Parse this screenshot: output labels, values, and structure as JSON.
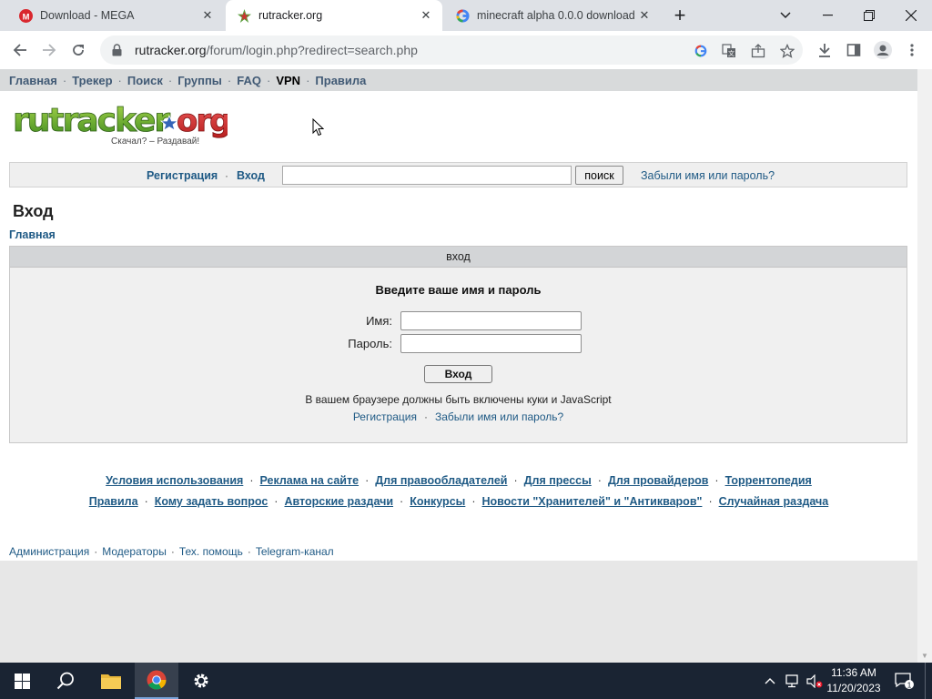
{
  "browser": {
    "tabs": [
      {
        "title": "Download - MEGA",
        "favicon": "mega-icon"
      },
      {
        "title": "rutracker.org",
        "favicon": "rutracker-icon",
        "active": true
      },
      {
        "title": "minecraft alpha 0.0.0 download",
        "favicon": "google-icon"
      }
    ],
    "new_tab_label": "+",
    "url_domain": "rutracker.org",
    "url_path": "/forum/login.php?redirect=search.php"
  },
  "topnav": {
    "items": [
      "Главная",
      "Трекер",
      "Поиск",
      "Группы",
      "FAQ",
      "VPN",
      "Правила"
    ]
  },
  "logo": {
    "wordmark": "rutracker.org",
    "tagline": "Скачал? – Раздавай!"
  },
  "loginbar": {
    "register": "Регистрация",
    "login": "Вход",
    "search_value": "",
    "search_button": "поиск",
    "forgot": "Забыли имя или пароль?"
  },
  "page": {
    "title": "Вход",
    "breadcrumb": "Главная"
  },
  "login_form": {
    "header": "вход",
    "prompt": "Введите ваше имя и пароль",
    "name_label": "Имя:",
    "name_value": "",
    "password_label": "Пароль:",
    "password_value": "",
    "submit": "Вход",
    "note": "В вашем браузере должны быть включены куки и JavaScript",
    "register_link": "Регистрация",
    "forgot_link": "Забыли имя или пароль?"
  },
  "footer": {
    "row1": [
      "Условия использования",
      "Реклама на сайте",
      "Для правообладателей",
      "Для прессы",
      "Для провайдеров",
      "Торрентопедия"
    ],
    "row2": [
      "Правила",
      "Кому задать вопрос",
      "Авторские раздачи",
      "Конкурсы",
      "Новости \"Хранителей\" и \"Антикваров\"",
      "Случайная раздача"
    ],
    "bottom": [
      "Администрация",
      "Модераторы",
      "Тех. помощь",
      "Telegram-канал"
    ]
  },
  "taskbar": {
    "time": "11:36 AM",
    "date": "11/20/2023",
    "notification_count": "1"
  },
  "colors": {
    "link": "#1f5a85",
    "nav_bg": "#d8dadb",
    "taskbar_bg": "#1a2433"
  }
}
